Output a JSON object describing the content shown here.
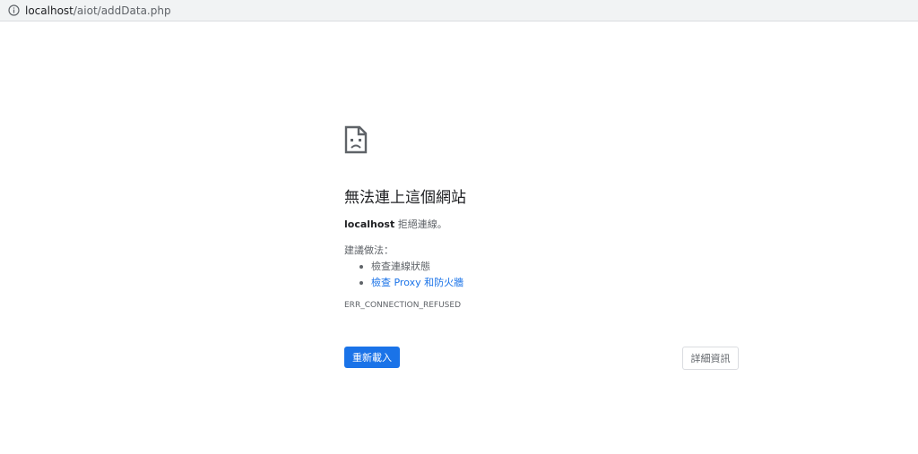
{
  "address_bar": {
    "host": "localhost",
    "path": "/aiot/addData.php",
    "icon": "info-icon"
  },
  "error_page": {
    "icon": "sad-page-icon",
    "title": "無法連上這個網站",
    "host_bold": "localhost",
    "description_suffix": " 拒絕連線。",
    "suggestions_label": "建議做法：",
    "suggestions": [
      {
        "label": "檢查連線狀態",
        "is_link": false
      },
      {
        "label": "檢查 Proxy 和防火牆",
        "is_link": true
      }
    ],
    "error_code": "ERR_CONNECTION_REFUSED",
    "reload_label": "重新載入",
    "details_label": "詳細資訊"
  },
  "colors": {
    "accent": "#1a73e8",
    "text_primary": "#202124",
    "text_secondary": "#5f6368",
    "toolbar_bg": "#f1f3f4"
  }
}
